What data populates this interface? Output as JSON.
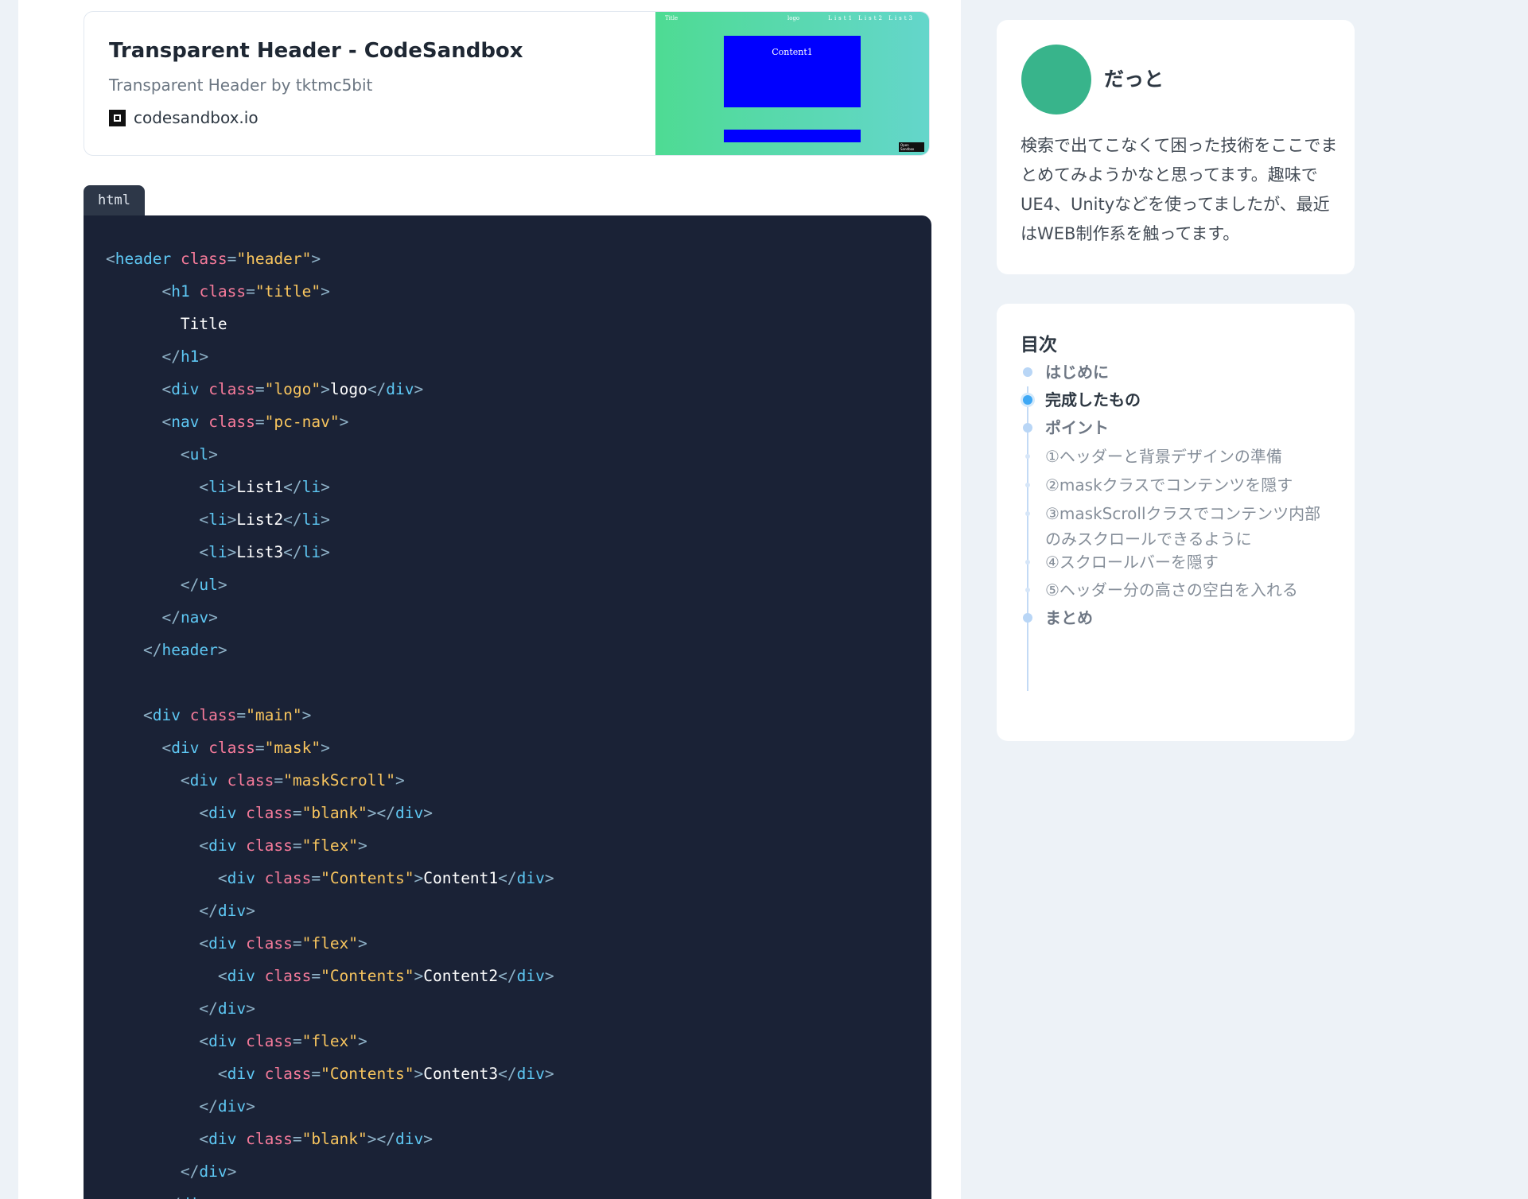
{
  "link_card": {
    "title": "Transparent Header - CodeSandbox",
    "description": "Transparent Header by tktmc5bit",
    "domain": "codesandbox.io",
    "thumbnail": {
      "title": "Title",
      "logo": "logo",
      "nav": "List1 List2 List3",
      "content1": "Content1",
      "badge": "Open Sandbox"
    }
  },
  "code": {
    "language": "html",
    "lines": [
      [
        [
          "p",
          "<"
        ],
        [
          "tag",
          "header"
        ],
        [
          "txt",
          " "
        ],
        [
          "attr",
          "class"
        ],
        [
          "p",
          "="
        ],
        [
          "str",
          "\"header\""
        ],
        [
          "p",
          ">"
        ]
      ],
      [
        [
          "txt",
          "      "
        ],
        [
          "p",
          "<"
        ],
        [
          "tag",
          "h1"
        ],
        [
          "txt",
          " "
        ],
        [
          "attr",
          "class"
        ],
        [
          "p",
          "="
        ],
        [
          "str",
          "\"title\""
        ],
        [
          "p",
          ">"
        ]
      ],
      [
        [
          "txt",
          "        Title"
        ]
      ],
      [
        [
          "txt",
          "      "
        ],
        [
          "p",
          "</"
        ],
        [
          "tag",
          "h1"
        ],
        [
          "p",
          ">"
        ]
      ],
      [
        [
          "txt",
          "      "
        ],
        [
          "p",
          "<"
        ],
        [
          "tag",
          "div"
        ],
        [
          "txt",
          " "
        ],
        [
          "attr",
          "class"
        ],
        [
          "p",
          "="
        ],
        [
          "str",
          "\"logo\""
        ],
        [
          "p",
          ">"
        ],
        [
          "txt",
          "logo"
        ],
        [
          "p",
          "</"
        ],
        [
          "tag",
          "div"
        ],
        [
          "p",
          ">"
        ]
      ],
      [
        [
          "txt",
          "      "
        ],
        [
          "p",
          "<"
        ],
        [
          "tag",
          "nav"
        ],
        [
          "txt",
          " "
        ],
        [
          "attr",
          "class"
        ],
        [
          "p",
          "="
        ],
        [
          "str",
          "\"pc-nav\""
        ],
        [
          "p",
          ">"
        ]
      ],
      [
        [
          "txt",
          "        "
        ],
        [
          "p",
          "<"
        ],
        [
          "tag",
          "ul"
        ],
        [
          "p",
          ">"
        ]
      ],
      [
        [
          "txt",
          "          "
        ],
        [
          "p",
          "<"
        ],
        [
          "tag",
          "li"
        ],
        [
          "p",
          ">"
        ],
        [
          "txt",
          "List1"
        ],
        [
          "p",
          "</"
        ],
        [
          "tag",
          "li"
        ],
        [
          "p",
          ">"
        ]
      ],
      [
        [
          "txt",
          "          "
        ],
        [
          "p",
          "<"
        ],
        [
          "tag",
          "li"
        ],
        [
          "p",
          ">"
        ],
        [
          "txt",
          "List2"
        ],
        [
          "p",
          "</"
        ],
        [
          "tag",
          "li"
        ],
        [
          "p",
          ">"
        ]
      ],
      [
        [
          "txt",
          "          "
        ],
        [
          "p",
          "<"
        ],
        [
          "tag",
          "li"
        ],
        [
          "p",
          ">"
        ],
        [
          "txt",
          "List3"
        ],
        [
          "p",
          "</"
        ],
        [
          "tag",
          "li"
        ],
        [
          "p",
          ">"
        ]
      ],
      [
        [
          "txt",
          "        "
        ],
        [
          "p",
          "</"
        ],
        [
          "tag",
          "ul"
        ],
        [
          "p",
          ">"
        ]
      ],
      [
        [
          "txt",
          "      "
        ],
        [
          "p",
          "</"
        ],
        [
          "tag",
          "nav"
        ],
        [
          "p",
          ">"
        ]
      ],
      [
        [
          "txt",
          "    "
        ],
        [
          "p",
          "</"
        ],
        [
          "tag",
          "header"
        ],
        [
          "p",
          ">"
        ]
      ],
      [],
      [
        [
          "txt",
          "    "
        ],
        [
          "p",
          "<"
        ],
        [
          "tag",
          "div"
        ],
        [
          "txt",
          " "
        ],
        [
          "attr",
          "class"
        ],
        [
          "p",
          "="
        ],
        [
          "str",
          "\"main\""
        ],
        [
          "p",
          ">"
        ]
      ],
      [
        [
          "txt",
          "      "
        ],
        [
          "p",
          "<"
        ],
        [
          "tag",
          "div"
        ],
        [
          "txt",
          " "
        ],
        [
          "attr",
          "class"
        ],
        [
          "p",
          "="
        ],
        [
          "str",
          "\"mask\""
        ],
        [
          "p",
          ">"
        ]
      ],
      [
        [
          "txt",
          "        "
        ],
        [
          "p",
          "<"
        ],
        [
          "tag",
          "div"
        ],
        [
          "txt",
          " "
        ],
        [
          "attr",
          "class"
        ],
        [
          "p",
          "="
        ],
        [
          "str",
          "\"maskScroll\""
        ],
        [
          "p",
          ">"
        ]
      ],
      [
        [
          "txt",
          "          "
        ],
        [
          "p",
          "<"
        ],
        [
          "tag",
          "div"
        ],
        [
          "txt",
          " "
        ],
        [
          "attr",
          "class"
        ],
        [
          "p",
          "="
        ],
        [
          "str",
          "\"blank\""
        ],
        [
          "p",
          "></"
        ],
        [
          "tag",
          "div"
        ],
        [
          "p",
          ">"
        ]
      ],
      [
        [
          "txt",
          "          "
        ],
        [
          "p",
          "<"
        ],
        [
          "tag",
          "div"
        ],
        [
          "txt",
          " "
        ],
        [
          "attr",
          "class"
        ],
        [
          "p",
          "="
        ],
        [
          "str",
          "\"flex\""
        ],
        [
          "p",
          ">"
        ]
      ],
      [
        [
          "txt",
          "            "
        ],
        [
          "p",
          "<"
        ],
        [
          "tag",
          "div"
        ],
        [
          "txt",
          " "
        ],
        [
          "attr",
          "class"
        ],
        [
          "p",
          "="
        ],
        [
          "str",
          "\"Contents\""
        ],
        [
          "p",
          ">"
        ],
        [
          "txt",
          "Content1"
        ],
        [
          "p",
          "</"
        ],
        [
          "tag",
          "div"
        ],
        [
          "p",
          ">"
        ]
      ],
      [
        [
          "txt",
          "          "
        ],
        [
          "p",
          "</"
        ],
        [
          "tag",
          "div"
        ],
        [
          "p",
          ">"
        ]
      ],
      [
        [
          "txt",
          "          "
        ],
        [
          "p",
          "<"
        ],
        [
          "tag",
          "div"
        ],
        [
          "txt",
          " "
        ],
        [
          "attr",
          "class"
        ],
        [
          "p",
          "="
        ],
        [
          "str",
          "\"flex\""
        ],
        [
          "p",
          ">"
        ]
      ],
      [
        [
          "txt",
          "            "
        ],
        [
          "p",
          "<"
        ],
        [
          "tag",
          "div"
        ],
        [
          "txt",
          " "
        ],
        [
          "attr",
          "class"
        ],
        [
          "p",
          "="
        ],
        [
          "str",
          "\"Contents\""
        ],
        [
          "p",
          ">"
        ],
        [
          "txt",
          "Content2"
        ],
        [
          "p",
          "</"
        ],
        [
          "tag",
          "div"
        ],
        [
          "p",
          ">"
        ]
      ],
      [
        [
          "txt",
          "          "
        ],
        [
          "p",
          "</"
        ],
        [
          "tag",
          "div"
        ],
        [
          "p",
          ">"
        ]
      ],
      [
        [
          "txt",
          "          "
        ],
        [
          "p",
          "<"
        ],
        [
          "tag",
          "div"
        ],
        [
          "txt",
          " "
        ],
        [
          "attr",
          "class"
        ],
        [
          "p",
          "="
        ],
        [
          "str",
          "\"flex\""
        ],
        [
          "p",
          ">"
        ]
      ],
      [
        [
          "txt",
          "            "
        ],
        [
          "p",
          "<"
        ],
        [
          "tag",
          "div"
        ],
        [
          "txt",
          " "
        ],
        [
          "attr",
          "class"
        ],
        [
          "p",
          "="
        ],
        [
          "str",
          "\"Contents\""
        ],
        [
          "p",
          ">"
        ],
        [
          "txt",
          "Content3"
        ],
        [
          "p",
          "</"
        ],
        [
          "tag",
          "div"
        ],
        [
          "p",
          ">"
        ]
      ],
      [
        [
          "txt",
          "          "
        ],
        [
          "p",
          "</"
        ],
        [
          "tag",
          "div"
        ],
        [
          "p",
          ">"
        ]
      ],
      [
        [
          "txt",
          "          "
        ],
        [
          "p",
          "<"
        ],
        [
          "tag",
          "div"
        ],
        [
          "txt",
          " "
        ],
        [
          "attr",
          "class"
        ],
        [
          "p",
          "="
        ],
        [
          "str",
          "\"blank\""
        ],
        [
          "p",
          "></"
        ],
        [
          "tag",
          "div"
        ],
        [
          "p",
          ">"
        ]
      ],
      [
        [
          "txt",
          "        "
        ],
        [
          "p",
          "</"
        ],
        [
          "tag",
          "div"
        ],
        [
          "p",
          ">"
        ]
      ],
      [
        [
          "txt",
          "      "
        ],
        [
          "p",
          "</"
        ],
        [
          "tag",
          "div"
        ],
        [
          "p",
          ">"
        ]
      ]
    ]
  },
  "profile": {
    "name": "だっと",
    "bio": "検索で出てこなくて困った技術をここでまとめてみようかなと思ってます。趣味でUE4、Unityなどを使ってましたが、最近はWEB制作系を触ってます。",
    "avatar_color": "#38b48b"
  },
  "toc": {
    "heading": "目次",
    "items": [
      {
        "label": "はじめに",
        "level": 2,
        "active": false
      },
      {
        "label": "完成したもの",
        "level": 2,
        "active": true
      },
      {
        "label": "ポイント",
        "level": 2,
        "active": false
      },
      {
        "label": "①ヘッダーと背景デザインの準備",
        "level": 3,
        "active": false
      },
      {
        "label": "②maskクラスでコンテンツを隠す",
        "level": 3,
        "active": false
      },
      {
        "label": "③maskScrollクラスでコンテンツ内部のみスクロールできるように",
        "level": 3,
        "active": false
      },
      {
        "label": "④スクロールバーを隠す",
        "level": 3,
        "active": false
      },
      {
        "label": "⑤ヘッダー分の高さの空白を入れる",
        "level": 3,
        "active": false
      },
      {
        "label": "まとめ",
        "level": 2,
        "active": false
      }
    ]
  },
  "colors": {
    "page_bg": "#edf2f7",
    "code_bg": "#1a2236",
    "code_tag": "#5ec8f4",
    "code_attr": "#f77b9b",
    "code_string": "#f8c55e",
    "toc_active": "#3ea8f5"
  }
}
